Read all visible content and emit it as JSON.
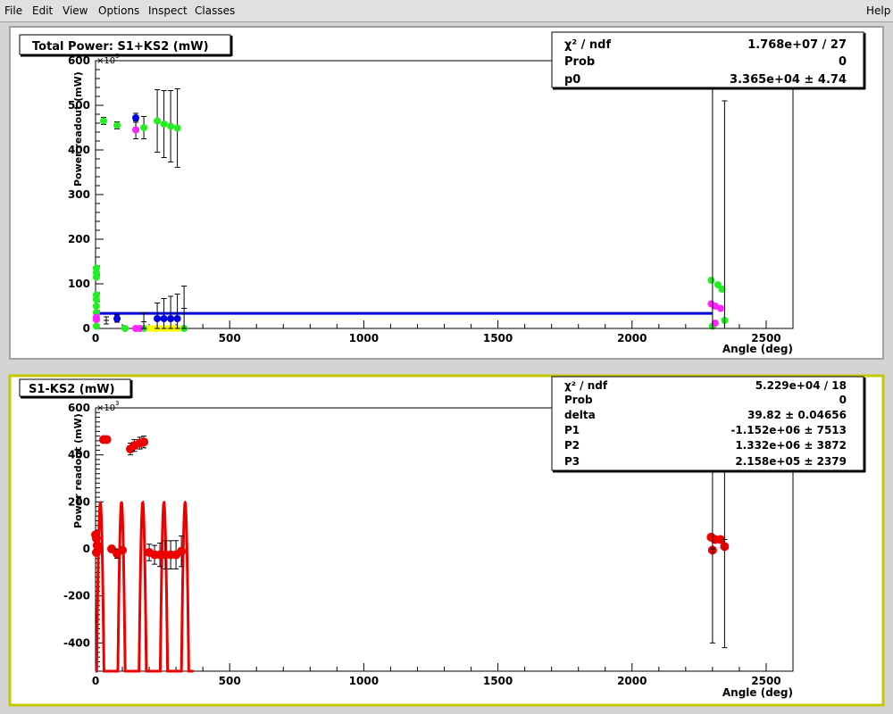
{
  "menu": {
    "file": "File",
    "edit": "Edit",
    "view": "View",
    "options": "Options",
    "inspect": "Inspect",
    "classes": "Classes",
    "help": "Help"
  },
  "colors": {
    "green": "#22ee22",
    "magenta": "#ff22ff",
    "blue": "#0000dd",
    "yellow": "#ffff00",
    "red": "#ee0000",
    "selected_pad_border": "#c8c800"
  },
  "chart_data": [
    {
      "type": "scatter",
      "title": "Total Power: S1+KS2 (mW)",
      "xlabel": "Angle (deg)",
      "ylabel": "Power readout (mW)",
      "y_exponent": "×10",
      "y_exponent_power": "3",
      "xlim": [
        0,
        2600
      ],
      "ylim": [
        0,
        600
      ],
      "xticks": [
        0,
        500,
        1000,
        1500,
        2000,
        2500
      ],
      "yticks": [
        0,
        100,
        200,
        300,
        400,
        500,
        600
      ],
      "fit_line": {
        "color": "blue",
        "y": 33.65,
        "x_range": [
          0,
          2300
        ]
      },
      "stats": {
        "rows": [
          {
            "label": "χ² / ndf",
            "value": "1.768e+07 / 27"
          },
          {
            "label": "Prob",
            "value": "0"
          },
          {
            "label": "p0",
            "value": "3.365e+04 ±  4.74"
          }
        ]
      },
      "series": [
        {
          "color": "green",
          "points": [
            {
              "x": 3,
              "y": 135,
              "e": 0
            },
            {
              "x": 3,
              "y": 125,
              "e": 0
            },
            {
              "x": 3,
              "y": 115,
              "e": 0
            },
            {
              "x": 3,
              "y": 75,
              "e": 0
            },
            {
              "x": 3,
              "y": 65,
              "e": 0
            },
            {
              "x": 3,
              "y": 50,
              "e": 0
            },
            {
              "x": 3,
              "y": 35,
              "e": 0
            },
            {
              "x": 3,
              "y": 5,
              "e": 0
            },
            {
              "x": 30,
              "y": 465,
              "e": 8
            },
            {
              "x": 80,
              "y": 455,
              "e": 8
            },
            {
              "x": 150,
              "y": 445,
              "e": 20
            },
            {
              "x": 180,
              "y": 450,
              "e": 25
            },
            {
              "x": 230,
              "y": 465,
              "e": 70
            },
            {
              "x": 255,
              "y": 458,
              "e": 75
            },
            {
              "x": 280,
              "y": 453,
              "e": 80
            },
            {
              "x": 305,
              "y": 449,
              "e": 88
            },
            {
              "x": 110,
              "y": 0,
              "e": 0
            },
            {
              "x": 180,
              "y": 0,
              "e": 0
            },
            {
              "x": 330,
              "y": 0,
              "e": 0
            },
            {
              "x": 2295,
              "y": 108,
              "e": 0
            },
            {
              "x": 2320,
              "y": 98,
              "e": 0
            },
            {
              "x": 2335,
              "y": 88,
              "e": 0
            },
            {
              "x": 2345,
              "y": 18,
              "e": 0
            },
            {
              "x": 2300,
              "y": 5,
              "e": 0
            }
          ]
        },
        {
          "color": "magenta",
          "points": [
            {
              "x": 3,
              "y": 25,
              "e": 0
            },
            {
              "x": 3,
              "y": 20,
              "e": 0
            },
            {
              "x": 150,
              "y": 445,
              "e": 0
            },
            {
              "x": 150,
              "y": 0,
              "e": 0
            },
            {
              "x": 165,
              "y": 0,
              "e": 0
            },
            {
              "x": 2295,
              "y": 55,
              "e": 0
            },
            {
              "x": 2310,
              "y": 50,
              "e": 0
            },
            {
              "x": 2330,
              "y": 45,
              "e": 0
            },
            {
              "x": 2310,
              "y": 12,
              "e": 0
            }
          ]
        },
        {
          "color": "yellow",
          "points": [
            {
              "x": 205,
              "y": 0,
              "e": 0
            },
            {
              "x": 225,
              "y": 0,
              "e": 0
            },
            {
              "x": 245,
              "y": 0,
              "e": 0
            },
            {
              "x": 265,
              "y": 0,
              "e": 0
            },
            {
              "x": 285,
              "y": 0,
              "e": 0
            },
            {
              "x": 305,
              "y": 0,
              "e": 0
            }
          ]
        },
        {
          "color": "blue",
          "points": [
            {
              "x": 150,
              "y": 472,
              "e": 10
            },
            {
              "x": 80,
              "y": 22,
              "e": 8
            },
            {
              "x": 230,
              "y": 22,
              "e": 35
            },
            {
              "x": 255,
              "y": 22,
              "e": 45
            },
            {
              "x": 280,
              "y": 22,
              "e": 50
            },
            {
              "x": 305,
              "y": 22,
              "e": 55
            }
          ]
        },
        {
          "color": "black",
          "points": [
            {
              "x": 40,
              "y": 18,
              "e": 8
            },
            {
              "x": 180,
              "y": 15,
              "e": 20
            },
            {
              "x": 330,
              "y": 45,
              "e": 50
            },
            {
              "x": 2300,
              "y": 0,
              "e": 610
            },
            {
              "x": 2345,
              "y": 0,
              "e": 510
            }
          ]
        }
      ]
    },
    {
      "type": "scatter",
      "title": "S1-KS2 (mW)",
      "xlabel": "Angle (deg)",
      "ylabel": "Power readout (mW)",
      "y_exponent": "×10",
      "y_exponent_power": "3",
      "xlim": [
        0,
        2600
      ],
      "ylim": [
        -520,
        600
      ],
      "xticks": [
        0,
        500,
        1000,
        1500,
        2000,
        2500
      ],
      "yticks": [
        -400,
        -200,
        0,
        200,
        400,
        600
      ],
      "fit_curve": {
        "color": "red",
        "model": "P1 + P2*sin(x*(delta*π/180)) + P3*cos(x*(delta*π/180))",
        "x_range": [
          0,
          365
        ],
        "P1": -1152,
        "P2": 1332,
        "P3": 215.8,
        "delta": 0.0795
      },
      "stats": {
        "rows": [
          {
            "label": "χ² / ndf",
            "value": "5.229e+04 / 18"
          },
          {
            "label": "Prob",
            "value": "0"
          },
          {
            "label": "delta",
            "value": "39.82 ± 0.04656"
          },
          {
            "label": "P1",
            "value": "-1.152e+06 ±  7513"
          },
          {
            "label": "P2",
            "value": "1.332e+06 ±  3872"
          },
          {
            "label": "P3",
            "value": "2.158e+05 ±  2379"
          }
        ]
      },
      "series": [
        {
          "color": "red",
          "points": [
            {
              "x": 0,
              "y": 60,
              "e": 0
            },
            {
              "x": 3,
              "y": 45,
              "e": 0
            },
            {
              "x": 6,
              "y": 15,
              "e": 0
            },
            {
              "x": 10,
              "y": 0,
              "e": 0
            },
            {
              "x": 3,
              "y": -15,
              "e": 0
            },
            {
              "x": 30,
              "y": 465,
              "e": 12
            },
            {
              "x": 42,
              "y": 465,
              "e": 12
            },
            {
              "x": 60,
              "y": 0,
              "e": 0
            },
            {
              "x": 80,
              "y": -20,
              "e": 20
            },
            {
              "x": 100,
              "y": -5,
              "e": 0
            },
            {
              "x": 130,
              "y": 425,
              "e": 25
            },
            {
              "x": 145,
              "y": 440,
              "e": 25
            },
            {
              "x": 165,
              "y": 450,
              "e": 25
            },
            {
              "x": 180,
              "y": 455,
              "e": 25
            },
            {
              "x": 200,
              "y": -15,
              "e": 35
            },
            {
              "x": 220,
              "y": -25,
              "e": 40
            },
            {
              "x": 240,
              "y": -25,
              "e": 50
            },
            {
              "x": 260,
              "y": -25,
              "e": 60
            },
            {
              "x": 280,
              "y": -25,
              "e": 60
            },
            {
              "x": 300,
              "y": -25,
              "e": 60
            },
            {
              "x": 320,
              "y": -10,
              "e": 65
            },
            {
              "x": 2295,
              "y": 50,
              "e": 0
            },
            {
              "x": 2310,
              "y": 40,
              "e": 0
            },
            {
              "x": 2330,
              "y": 40,
              "e": 0
            },
            {
              "x": 2345,
              "y": 10,
              "e": 0
            },
            {
              "x": 2300,
              "y": -5,
              "e": 0
            }
          ]
        },
        {
          "color": "black",
          "points": [
            {
              "x": 2300,
              "y": 0,
              "e": 400
            },
            {
              "x": 2345,
              "y": 40,
              "e": 460
            }
          ]
        }
      ]
    }
  ]
}
